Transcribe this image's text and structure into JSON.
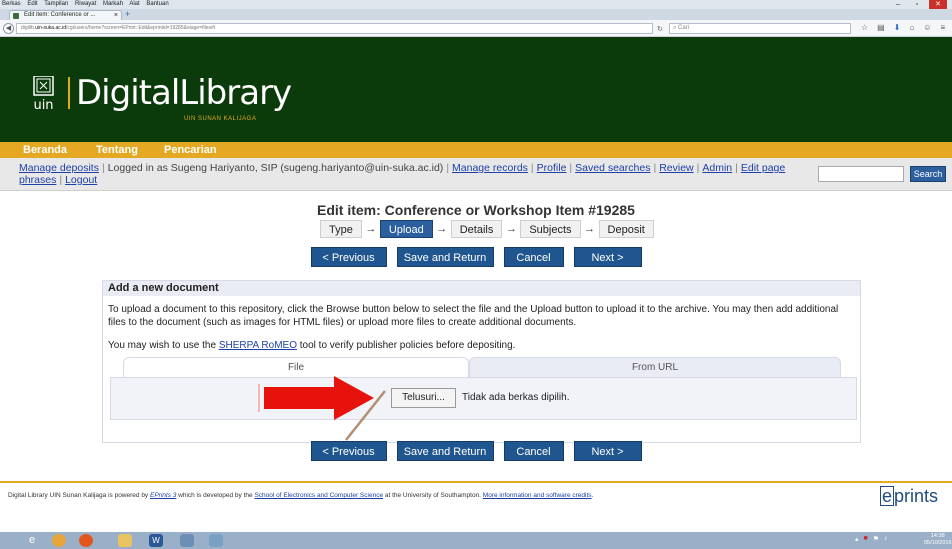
{
  "browser": {
    "menu": [
      "Berkas",
      "Edit",
      "Tampilan",
      "Riwayat",
      "Markah",
      "Alat",
      "Bantuan"
    ],
    "tab_title": "Edit item: Conference or ...",
    "url_prefix": "digilib.",
    "url_host": "uin-suka.ac.id",
    "url_rest": "/cgi/users/home?screen=EPrint::Edit&eprintid=19285&stage=files#t",
    "search_placeholder": "Cari"
  },
  "site": {
    "logo_digital": "Digital",
    "logo_library": "Library",
    "logo_sub": "UIN SUNAN KALIJAGA"
  },
  "nav": [
    "Beranda",
    "Tentang",
    "Pencarian"
  ],
  "login": {
    "manage_deposits": "Manage deposits",
    "logged_in_text": "Logged in as Sugeng Hariyanto, SIP (sugeng.hariyanto@uin-suka.ac.id)",
    "manage_records": "Manage records",
    "profile": "Profile",
    "saved_searches": "Saved searches",
    "review": "Review",
    "admin": "Admin",
    "edit_page_phrases": "Edit page phrases",
    "logout": "Logout",
    "search_button": "Search"
  },
  "page": {
    "title": "Edit item: Conference or Workshop Item #19285",
    "workflow": [
      "Type",
      "Upload",
      "Details",
      "Subjects",
      "Deposit"
    ],
    "arrow": "→",
    "buttons": {
      "previous": "< Previous",
      "save_return": "Save and Return",
      "cancel": "Cancel",
      "next": "Next >"
    }
  },
  "doc": {
    "heading": "Add a new document",
    "instructions": "To upload a document to this repository, click the Browse button below to select the file and the Upload button to upload it to the archive. You may then add additional files to the document (such as images for HTML files) or upload more files to create additional documents.",
    "sherpa_before": "You may wish to use the ",
    "sherpa_link": "SHERPA RoMEO",
    "sherpa_after": " tool to verify publisher policies before depositing.",
    "tab_file": "File",
    "tab_url": "From URL",
    "browse_button": "Telusuri...",
    "no_file": "Tidak ada berkas dipilih."
  },
  "footer": {
    "text1": "Digital Library UIN Sunan Kalijaga is powered by ",
    "eprints_link": "EPrints 3",
    "text2": " which is developed by the ",
    "school_link": "School of Electronics and Computer Science",
    "text3": " at the University of Southampton. ",
    "more_link": "More information and software credits",
    "text4": ".",
    "logo_e": "e",
    "logo_rest": "prints"
  },
  "taskbar": {
    "time": "14:38",
    "date": "05/10/2016"
  },
  "colors": {
    "header_green": "#0b3b0b",
    "nav_orange": "#e5a823",
    "button_blue": "#20568f",
    "arrow_red": "#e8120c"
  }
}
